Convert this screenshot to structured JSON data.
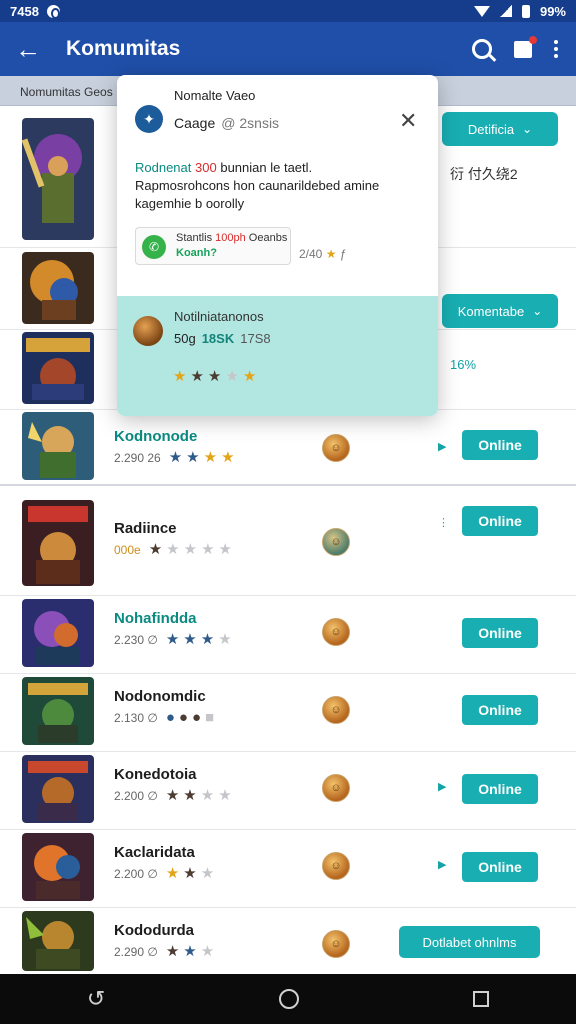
{
  "status_bar": {
    "time": "7458",
    "battery": "99%"
  },
  "app_bar": {
    "title": "Komumitas"
  },
  "subheader": {
    "text": "Nomumitas Geos"
  },
  "popup": {
    "header_title": "Nomalte Vaeo",
    "sub_name": "Caage",
    "sub_meta": "@ 2snsis",
    "message_highlight": "Rodnenat",
    "message_red": "300",
    "message_rest": "bunnian le taetl.",
    "message_line2": "Rapmosrohcons hon caunarildebed amine",
    "message_line3": "kagemhie b oorolly",
    "card_line1_a": "Stantlis",
    "card_line1_red": "100ph",
    "card_line1_b": "Oeanbs",
    "card_line2": "Koanh?",
    "card_side": "2/40",
    "card_side_extra": "ƒ",
    "band_title": "Notilniatanonos",
    "band_a": "50g",
    "band_b": "18SK",
    "band_c": "17S8",
    "band_stars": [
      "gold",
      "dark",
      "dark",
      "gray",
      "gold"
    ]
  },
  "rows": [
    {
      "side_button": "Detificia",
      "side_text": "衍 付久绕2"
    },
    {
      "side_button": "Komentabe",
      "side_pct": "16%"
    },
    {
      "name": "Kodnonode",
      "num": "2.290 26",
      "stars": [
        "blue",
        "blue",
        "gold",
        "gold"
      ],
      "button": "Online"
    },
    {
      "name": "Radiince",
      "num": "000e",
      "stars": [
        "dark",
        "gray",
        "gray",
        "gray",
        "gray"
      ],
      "button": "Online"
    },
    {
      "name": "Nohafindda",
      "num": "2.230 ∅",
      "stars": [
        "blue",
        "blue",
        "blue",
        "gray"
      ],
      "button": "Online"
    },
    {
      "name": "Nodonomdic",
      "num": "2.130 ∅",
      "stars": [
        "blue",
        "dark",
        "dark",
        "gray"
      ],
      "button": "Online"
    },
    {
      "name": "Konedotoia",
      "num": "2.200 ∅",
      "stars": [
        "dark",
        "dark",
        "gray",
        "gray"
      ],
      "button": "Online"
    },
    {
      "name": "Kaclaridata",
      "num": "2.200 ∅",
      "stars": [
        "gold",
        "dark",
        "gray"
      ],
      "button": "Online"
    },
    {
      "name": "Kododurda",
      "num": "2.290 ∅",
      "stars": [
        "dark",
        "blue",
        "gray"
      ],
      "button": "Dotlabet ohnlms"
    }
  ],
  "colors": {
    "appbar": "#1f4fa8",
    "accent": "#18aeb2",
    "status_bar": "#163c8c"
  }
}
